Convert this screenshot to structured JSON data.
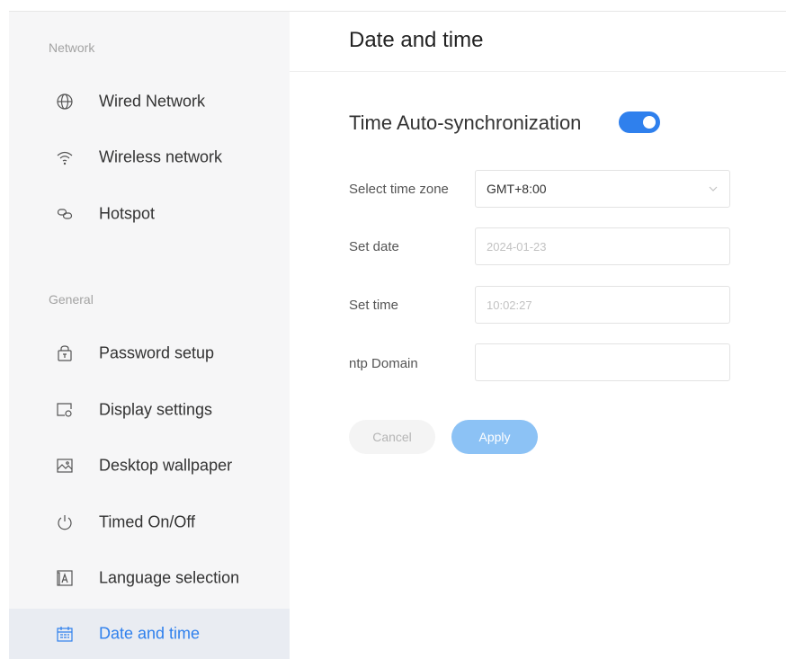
{
  "sidebar": {
    "sections": [
      {
        "label": "Network"
      },
      {
        "label": "General"
      }
    ],
    "items": [
      {
        "label": "Wired Network",
        "icon": "globe-icon"
      },
      {
        "label": "Wireless network",
        "icon": "wifi-icon"
      },
      {
        "label": "Hotspot",
        "icon": "hotspot-icon"
      },
      {
        "label": "Password setup",
        "icon": "lock-icon"
      },
      {
        "label": "Display settings",
        "icon": "display-icon"
      },
      {
        "label": "Desktop wallpaper",
        "icon": "image-icon"
      },
      {
        "label": "Timed On/Off",
        "icon": "power-icon"
      },
      {
        "label": "Language selection",
        "icon": "language-icon"
      },
      {
        "label": "Date and time",
        "icon": "calendar-icon",
        "active": true
      }
    ]
  },
  "main": {
    "title": "Date and time",
    "auto_sync": {
      "label": "Time Auto-synchronization",
      "enabled": true
    },
    "fields": {
      "timezone": {
        "label": "Select time zone",
        "value": "GMT+8:00"
      },
      "date": {
        "label": "Set date",
        "value": "2024-01-23"
      },
      "time": {
        "label": "Set time",
        "value": "10:02:27"
      },
      "ntp": {
        "label": "ntp Domain",
        "value": ""
      }
    },
    "buttons": {
      "cancel": "Cancel",
      "apply": "Apply"
    }
  },
  "colors": {
    "accent": "#2f80ed",
    "sidebar_bg": "#f6f6f7",
    "active_bg": "#e9ecf2",
    "apply_disabled": "#8cc2f5"
  }
}
